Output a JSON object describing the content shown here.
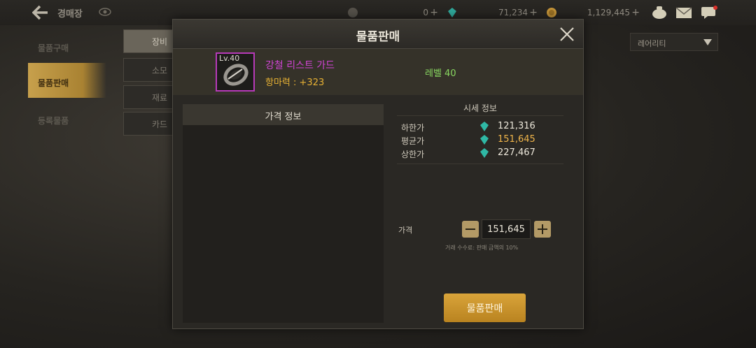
{
  "topbar": {
    "title": "경매장",
    "currency1": "0",
    "currency2": "71,234",
    "currency3": "1,129,445",
    "icons": [
      "back-arrow-icon",
      "eye-icon",
      "moon-coin-icon",
      "gem-icon",
      "gold-coin-icon",
      "pot-icon",
      "mail-icon",
      "chat-icon"
    ]
  },
  "left_tabs": [
    "물품구매",
    "물품판매",
    "등록물품"
  ],
  "sub_tabs": [
    "장비",
    "소모",
    "재료",
    "카드"
  ],
  "filter": {
    "selected": "레어리티"
  },
  "modal": {
    "title": "물품판매",
    "item": {
      "level_badge": "Lv.40",
      "name": "강철 리스트 가드",
      "stat": "항마력 : +323",
      "level": "레벨 40"
    },
    "price_info_header": "가격 정보",
    "market": {
      "header": "시세 정보",
      "rows": [
        {
          "label": "하한가",
          "value": "121,316"
        },
        {
          "label": "평균가",
          "value": "151,645"
        },
        {
          "label": "상한가",
          "value": "227,467"
        }
      ]
    },
    "price_label": "가격",
    "price_value": "151,645",
    "fee_note": "거래 수수료: 판매 금액의 10%",
    "sell_button": "물품판매"
  },
  "colors": {
    "item_name": "#d244d6",
    "stat": "#e8b234",
    "level": "#88d660",
    "accent": "#c7a04c"
  }
}
